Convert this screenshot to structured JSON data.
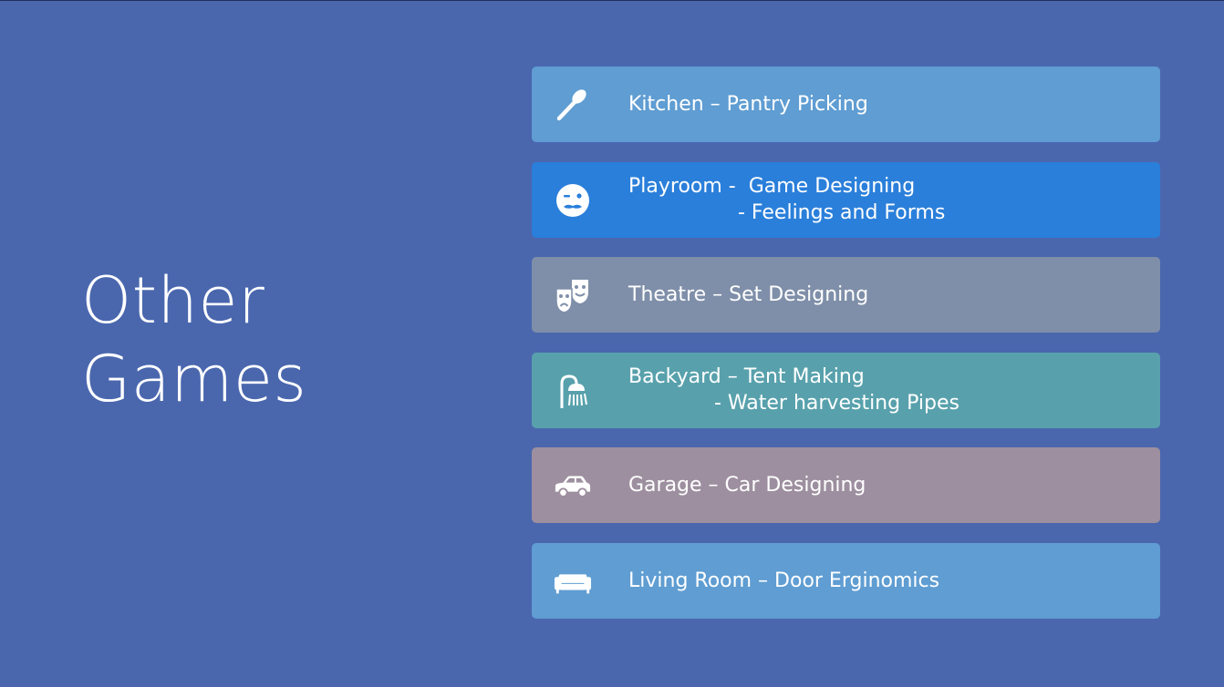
{
  "title": {
    "line1": "Other",
    "line2": "Games"
  },
  "items": [
    {
      "label": "Kitchen – Pantry Picking",
      "line2": "",
      "icon": "spoon-icon",
      "color": "#5f9dd2"
    },
    {
      "label": "Playroom -  Game Designing",
      "line2": "- Feelings and Forms",
      "icon": "face-icon",
      "color": "#2a7fda"
    },
    {
      "label": "Theatre – Set Designing",
      "line2": "",
      "icon": "theatre-masks-icon",
      "color": "#7f8fa9"
    },
    {
      "label": "Backyard – Tent Making",
      "line2": "- Water harvesting Pipes",
      "icon": "shower-icon",
      "color": "#58a1ac"
    },
    {
      "label": "Garage – Car Designing",
      "line2": "",
      "icon": "car-icon",
      "color": "#9d8f9f"
    },
    {
      "label": "Living Room – Door Erginomics",
      "line2": "",
      "icon": "sofa-icon",
      "color": "#5f9dd2"
    }
  ]
}
